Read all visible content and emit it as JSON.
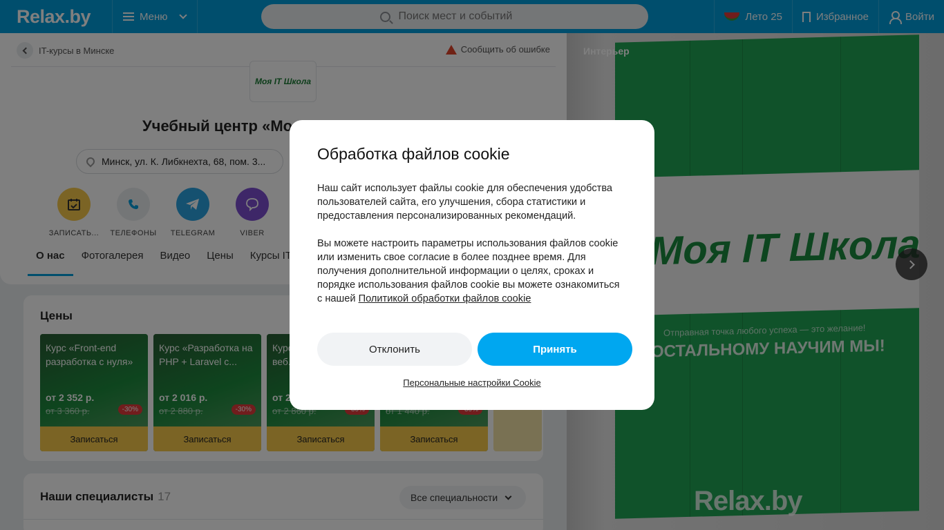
{
  "header": {
    "logo": "Relax.by",
    "menu_label": "Меню",
    "search_placeholder": "Поиск мест и событий",
    "summer_label": "Лето 25",
    "favorites_label": "Избранное",
    "login_label": "Войти"
  },
  "page": {
    "back_label": "IT-курсы в Минске",
    "report_label": "Сообщить об ошибке",
    "logo_text": "Моя IT Школа",
    "title": "Учебный центр «Моя IT Школа»",
    "address": "Минск, ул. К. Либкнехта, 68, пом. 3...",
    "actions": [
      {
        "label": "ЗАПИСАТЬ...",
        "icon": "calendar-check-icon",
        "color": "#f6c84b"
      },
      {
        "label": "ТЕЛЕФОНЫ",
        "icon": "phone-icon",
        "color": "#e9ecef"
      },
      {
        "label": "TELEGRAM",
        "icon": "telegram-icon",
        "color": "#2aa3e0"
      },
      {
        "label": "VIBER",
        "icon": "viber-icon",
        "color": "#7d4fd1"
      }
    ],
    "tabs": [
      "О нас",
      "Фотогалерея",
      "Видео",
      "Цены",
      "Курсы IT"
    ]
  },
  "prices": {
    "title": "Цены",
    "courses": [
      {
        "title": "Курс «Front-end разработка с нуля»",
        "price": "от 2 352 р.",
        "old_price": "от 3 360 р.",
        "discount": "-30%",
        "button": "Записаться"
      },
      {
        "title": "Курс «Разработка на PHP + Laravel с...",
        "price": "от 2 016 р.",
        "old_price": "от 2 880 р.",
        "discount": "-30%",
        "button": "Записаться"
      },
      {
        "title": "Курс «Разработка веб...",
        "price": "от 2 002 р.",
        "old_price": "от 2 860 р.",
        "discount": "-30%",
        "button": "Записаться"
      },
      {
        "title": "",
        "price": "",
        "old_price": "от 1 440 р.",
        "discount": "-30%",
        "button": "Записаться"
      }
    ]
  },
  "specialists": {
    "title": "Наши специалисты",
    "count": "17",
    "filter": "Все специальности"
  },
  "gallery": {
    "label": "Интерьер",
    "sign_brand": "Моя IT Школа",
    "slogan_small": "Отправная точка любого успеха — это желание!",
    "slogan_big": "ОСТАЛЬНОМУ НАУЧИМ МЫ!",
    "watermark": "Relax.by"
  },
  "cookie_modal": {
    "title": "Обработка файлов cookie",
    "paragraph1": "Наш сайт использует файлы cookie для обеспечения удобства пользователей сайта, его улучшения, сбора статистики и предоставления персонализированных рекомендаций.",
    "paragraph2": "Вы можете настроить параметры использования файлов cookie или изменить свое согласие в более позднее время. Для получения дополнительной информации о целях, сроках и порядке использования файлов cookie вы можете ознакомиться с нашей",
    "policy_link": "Политикой обработки файлов cookie",
    "decline_label": "Отклонить",
    "accept_label": "Принять",
    "settings_link": "Персональные настройки Cookie"
  }
}
